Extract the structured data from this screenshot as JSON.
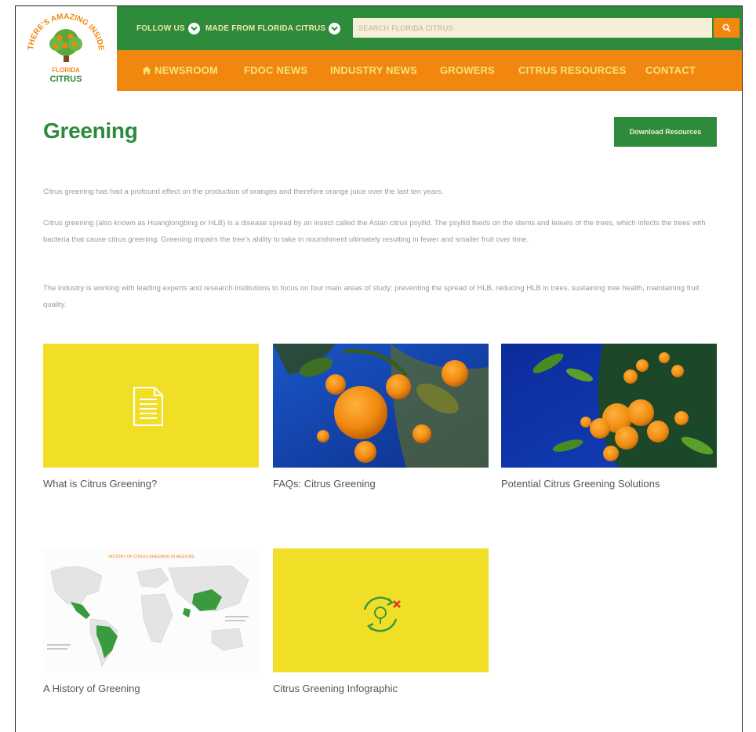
{
  "logo": {
    "arc_text": "THERE'S AMAZING INSIDE",
    "brand_line1": "FLORIDA",
    "brand_line2": "CITRUS"
  },
  "topbar": {
    "follow_label": "FOLLOW US",
    "made_label": "MADE FROM FLORIDA CITRUS",
    "search_placeholder": "SEARCH FLORIDA CITRUS"
  },
  "nav": {
    "items": [
      {
        "label": "NEWSROOM",
        "icon": "home-icon"
      },
      {
        "label": "FDOC NEWS"
      },
      {
        "label": "INDUSTRY NEWS"
      },
      {
        "label": "GROWERS"
      },
      {
        "label": "CITRUS RESOURCES"
      },
      {
        "label": "CONTACT"
      }
    ]
  },
  "page": {
    "title": "Greening",
    "download_label": "Download Resources",
    "paragraphs": [
      "Citrus greening has had a profound effect on the production of oranges and therefore orange juice over the last ten years.",
      "Citrus greening (also known as Huanglongbing or HLB) is a disease spread by an insect called the Asian citrus psyllid. The psyllid feeds on the stems and leaves of the trees, which infects the trees with bacteria that cause citrus greening. Greening impairs the tree's ability to take in nourishment ultimately resulting in fewer and smaller fruit over time.",
      "The industry is working with leading experts and research institutions to focus on four main areas of study: preventing the spread of HLB, reducing HLB in trees, sustaining tree health, maintaining fruit quality."
    ]
  },
  "cards": [
    {
      "label": "What is Citrus Greening?",
      "image": "document-icon"
    },
    {
      "label": "FAQs: Citrus Greening",
      "image": "oranges-photo"
    },
    {
      "label": "Potential Citrus Greening Solutions",
      "image": "orange-tree-photo"
    },
    {
      "label": "A History of Greening",
      "image": "world-map",
      "map_title": "HISTORY OF CITRUS GREENING IN REGIONS"
    },
    {
      "label": "Citrus Greening Infographic",
      "image": "cycle-icon"
    }
  ],
  "colors": {
    "green": "#2e8b3b",
    "orange": "#f2870f",
    "yellow": "#f1df27"
  }
}
